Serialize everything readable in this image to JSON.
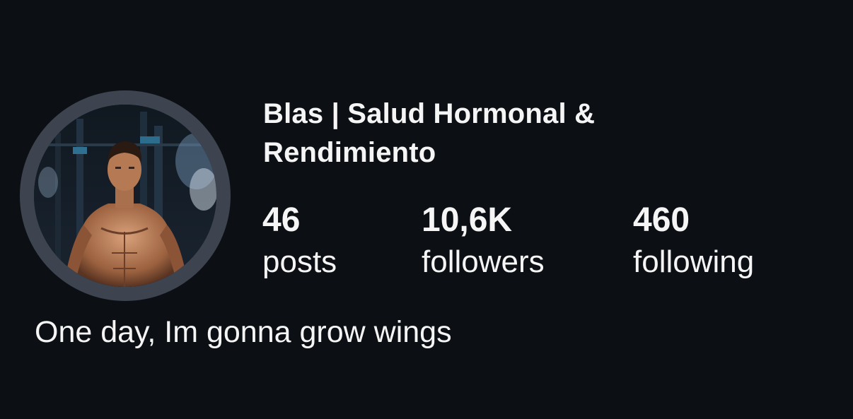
{
  "profile": {
    "display_name": "Blas | Salud Hormonal & Rendimiento",
    "avatar": {
      "icon": "profile-photo",
      "ring_color": "#3d4450"
    },
    "stats": [
      {
        "value": "46",
        "label": "posts"
      },
      {
        "value": "10,6K",
        "label": "followers"
      },
      {
        "value": "460",
        "label": "following"
      }
    ],
    "bio": "One day, Im gonna grow wings"
  },
  "colors": {
    "background": "#0c1014",
    "text": "#f5f5f5"
  }
}
